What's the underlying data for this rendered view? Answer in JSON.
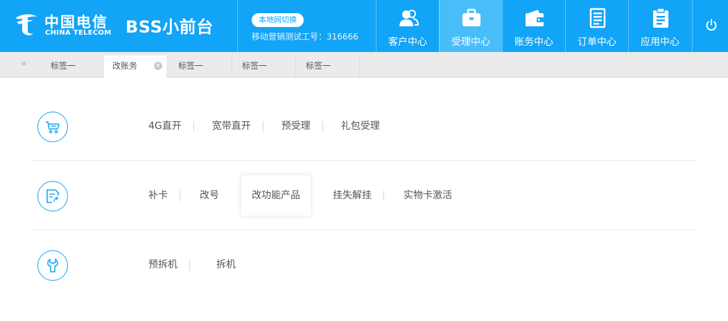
{
  "header": {
    "logo_cn": "中国电信",
    "logo_en": "CHINA TELECOM",
    "app_title": "BSS小前台",
    "region_button": "本地网切换",
    "operator_info": "移动营销测试工号：316666",
    "nav": [
      {
        "label": "客户中心",
        "icon": "users-icon",
        "active": false
      },
      {
        "label": "受理中心",
        "icon": "briefcase-icon",
        "active": true
      },
      {
        "label": "账务中心",
        "icon": "wallet-icon",
        "active": false
      },
      {
        "label": "订单中心",
        "icon": "document-icon",
        "active": false
      },
      {
        "label": "应用中心",
        "icon": "clipboard-icon",
        "active": false
      }
    ],
    "power_icon": "power-icon"
  },
  "tabs": [
    {
      "label": "标签一",
      "active": false
    },
    {
      "label": "改账务",
      "active": true,
      "closable": true
    },
    {
      "label": "标签一",
      "active": false
    },
    {
      "label": "标签一",
      "active": false
    },
    {
      "label": "标签一",
      "active": false
    }
  ],
  "rows": [
    {
      "icon": "cart-icon",
      "items": [
        "4G直开",
        "宽带直开",
        "预受理",
        "礼包受理"
      ]
    },
    {
      "icon": "edit-document-icon",
      "items": [
        "补卡",
        "改号",
        "改功能产品",
        "挂失解挂",
        "实物卡激活"
      ],
      "highlighted": "改功能产品"
    },
    {
      "icon": "wrench-icon",
      "items": [
        "预拆机",
        "拆机"
      ]
    }
  ],
  "colors": {
    "primary": "#12a4f6",
    "active_nav": "#49bdf8",
    "text": "#555555"
  }
}
